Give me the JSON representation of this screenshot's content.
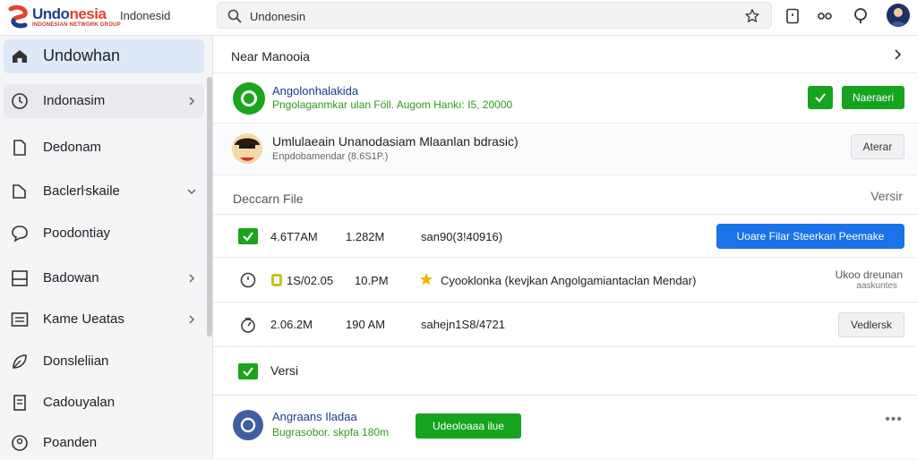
{
  "topbar": {
    "brand_main": "Undo",
    "brand_accent": "nesia",
    "brand_tag": "INDONESIAN NETWORK GROUP",
    "app_title": "Indonesid",
    "search_value": "Undonesin"
  },
  "sidebar": {
    "items": [
      {
        "label": "Undowhan",
        "icon": "home-icon",
        "chevron": false
      },
      {
        "label": "Indonasim",
        "icon": "clock-icon",
        "chevron": true
      },
      {
        "label": "Dedonam",
        "icon": "document-icon",
        "chevron": false
      },
      {
        "label": "Baclerŀskaile",
        "icon": "folder-icon",
        "chevron": "down"
      },
      {
        "label": "Poodontiay",
        "icon": "chat-icon",
        "chevron": false
      },
      {
        "label": "Badowan",
        "icon": "layout-icon",
        "chevron": true
      },
      {
        "label": "Kame Ueatas",
        "icon": "list-icon",
        "chevron": true
      },
      {
        "label": "Donsleliian",
        "icon": "leaf-icon",
        "chevron": false
      },
      {
        "label": "Cadouyalan",
        "icon": "file-icon",
        "chevron": false
      },
      {
        "label": "Poanden",
        "icon": "user-icon",
        "chevron": false
      }
    ]
  },
  "panel": {
    "title": "Near Manooia"
  },
  "card1": {
    "title": "Angolonhalakida",
    "subtitle": "Pngolaganmkar ulan Föll. Augom Hankı: I5, 20000",
    "button": "Naeraeri"
  },
  "card2": {
    "title": "Umlulaeain Unanodasiam Mlaanlan bdrasic)",
    "subtitle": "Enpdobamendar (8.6S1P.)",
    "button": "Aterar"
  },
  "files": {
    "heading": "Deccarn File",
    "version_label": "Versir",
    "rows": [
      {
        "col1": "4.6T7AM",
        "col2": "1.282M",
        "col3": "san90(3!40916)",
        "action": "Uoare Filar Steerkan Peemake"
      },
      {
        "col1": "1S/02.05",
        "col2": "10.PM",
        "col3": "Cyooklonka (kevjkan Angolgamiantaclan Mendar)",
        "action_line1": "Ukoo dreunan",
        "action_line2": "aaskuntes"
      },
      {
        "col1": "2.06.2M",
        "col2": "190 AM",
        "col3": "sahejn1S8/4721",
        "action": "Vedlersk"
      }
    ],
    "footer_label": "Versi"
  },
  "card3": {
    "title": "Angraans Iladaa",
    "subtitle": "Bugrasobor. skpfa 180m",
    "button": "Udeoloaaa ilue"
  },
  "colors": {
    "accent_green": "#16a31e",
    "accent_blue": "#1a73e8",
    "title_blue": "#1b3a8c"
  }
}
